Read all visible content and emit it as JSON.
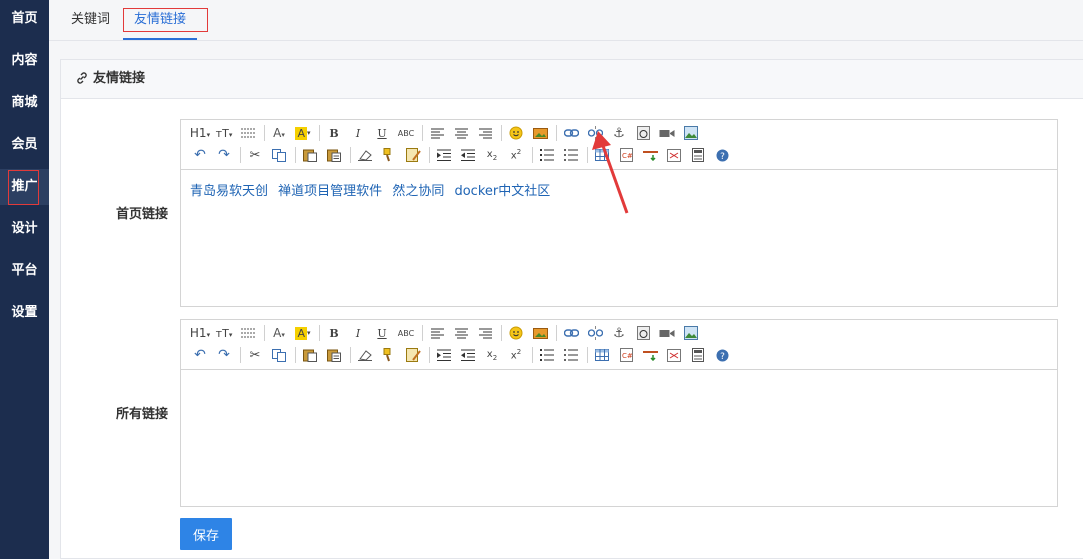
{
  "sidebar": {
    "items": [
      {
        "label": "首页"
      },
      {
        "label": "内容"
      },
      {
        "label": "商城"
      },
      {
        "label": "会员"
      },
      {
        "label": "推广",
        "active": true
      },
      {
        "label": "设计"
      },
      {
        "label": "平台"
      },
      {
        "label": "设置"
      }
    ]
  },
  "tabs": [
    {
      "label": "关键词"
    },
    {
      "label": "友情链接",
      "active": true
    }
  ],
  "panel": {
    "title": "友情链接",
    "icon": "link-icon"
  },
  "form": {
    "homepage_links": {
      "label": "首页链接",
      "links": [
        "青岛易软天创",
        "禅道项目管理软件",
        "然之协同",
        "docker中文社区"
      ]
    },
    "all_links": {
      "label": "所有链接",
      "content": ""
    },
    "save_label": "保存"
  },
  "toolbar": {
    "row1": [
      "heading-icon",
      "font-size-icon",
      "paragraph-icon",
      "font-color-icon",
      "highlight-color-icon",
      "bold-icon",
      "italic-icon",
      "underline-icon",
      "strikethrough-icon",
      "align-left-icon",
      "align-center-icon",
      "align-right-icon",
      "emoticon-icon",
      "image-icon",
      "link-icon",
      "unlink-icon",
      "anchor-icon",
      "flash-icon",
      "media-icon",
      "insert-image-icon"
    ],
    "row2": [
      "undo-icon",
      "redo-icon",
      "cut-icon",
      "copy-icon",
      "paste-icon",
      "paste-text-icon",
      "clear-format-icon",
      "format-brush-icon",
      "quick-format-icon",
      "indent-icon",
      "outdent-icon",
      "subscript-icon",
      "superscript-icon",
      "ordered-list-icon",
      "unordered-list-icon",
      "table-icon",
      "code-icon",
      "horizontal-line-icon",
      "page-break-icon",
      "template-icon",
      "help-icon"
    ]
  },
  "colors": {
    "sidebar": "#1c2d4e",
    "accent": "#2a6fd6",
    "button": "#2e84e6",
    "annotation": "#e23a3a",
    "link": "#1f64b4"
  }
}
